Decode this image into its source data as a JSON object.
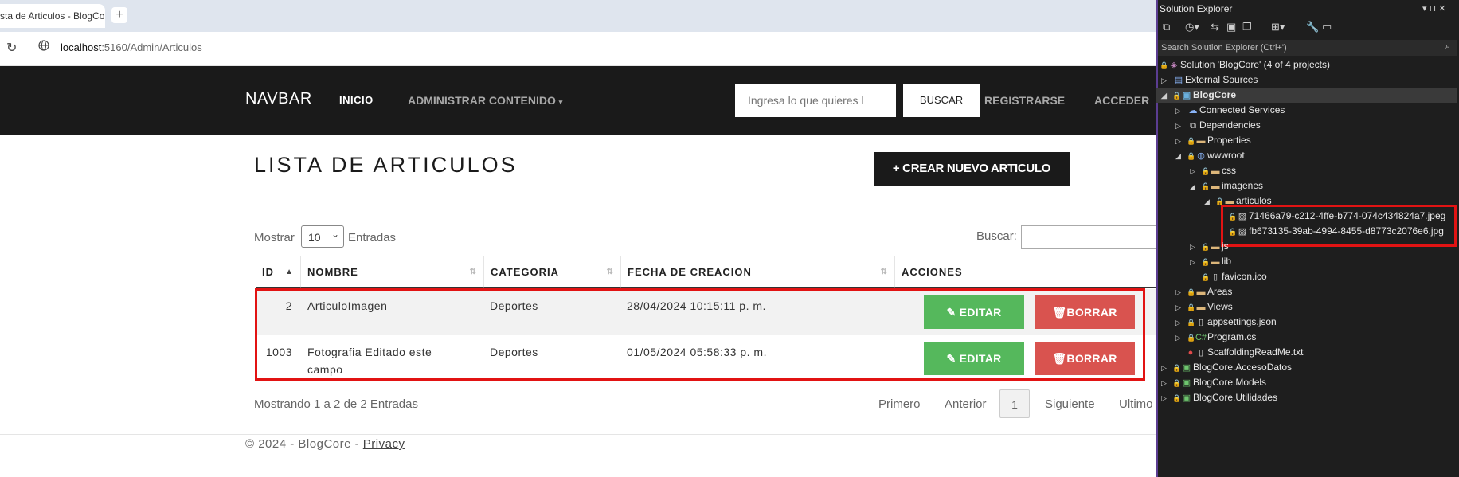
{
  "browser": {
    "tab_title": "sta de Articulos - BlogCore",
    "tab_add": "+",
    "reload_icon": "↻",
    "url_host": "localhost",
    "url_path": ":5160/Admin/Articulos"
  },
  "navbar": {
    "brand": "NAVBAR",
    "inicio": "INICIO",
    "admin": "ADMINISTRAR CONTENIDO",
    "search_placeholder": "Ingresa lo que quieres l",
    "search_button": "BUSCAR",
    "register": "REGISTRARSE",
    "login": "ACCEDER"
  },
  "page": {
    "title": "LISTA DE ARTICULOS",
    "create_button": "+ CREAR NUEVO ARTICULO",
    "show_label": "Mostrar",
    "page_length": "10",
    "entries_label": "Entradas",
    "search_label": "Buscar:",
    "info": "Mostrando 1 a 2 de 2 Entradas"
  },
  "table": {
    "headers": [
      "ID",
      "NOMBRE",
      "CATEGORIA",
      "FECHA DE CREACION",
      "ACCIONES"
    ],
    "rows": [
      {
        "id": "2",
        "nombre": "ArticuloImagen",
        "categoria": "Deportes",
        "fecha": "28/04/2024 10:15:11 p. m."
      },
      {
        "id": "1003",
        "nombre": "Fotografia Editado este",
        "nombre_2": "campo",
        "categoria": "Deportes",
        "fecha": "01/05/2024 05:58:33 p. m."
      }
    ],
    "edit_label": "EDITAR",
    "delete_label": "BORRAR"
  },
  "pagination": {
    "first": "Primero",
    "prev": "Anterior",
    "current": "1",
    "next": "Siguiente",
    "last": "Ultimo"
  },
  "footer": {
    "text": "© 2024 - BlogCore - ",
    "privacy": "Privacy"
  },
  "solution_explorer": {
    "title": "Solution Explorer",
    "search_placeholder": "Search Solution Explorer (Ctrl+')",
    "items": {
      "solution": "Solution 'BlogCore' (4 of 4 projects)",
      "external": "External Sources",
      "blogcore": "BlogCore",
      "connected": "Connected Services",
      "dependencies": "Dependencies",
      "properties": "Properties",
      "wwwroot": "wwwroot",
      "css": "css",
      "imagenes": "imagenes",
      "articulos": "articulos",
      "file1": "71466a79-c212-4ffe-b774-074c434824a7.jpeg",
      "file2": "fb673135-39ab-4994-8455-d8773c2076e6.jpg",
      "js": "js",
      "lib": "lib",
      "favicon": "favicon.ico",
      "areas": "Areas",
      "views": "Views",
      "appsettings": "appsettings.json",
      "program": "Program.cs",
      "scaffolding": "ScaffoldingReadMe.txt",
      "accesodatos": "BlogCore.AccesoDatos",
      "models": "BlogCore.Models",
      "utilidades": "BlogCore.Utilidades"
    }
  }
}
